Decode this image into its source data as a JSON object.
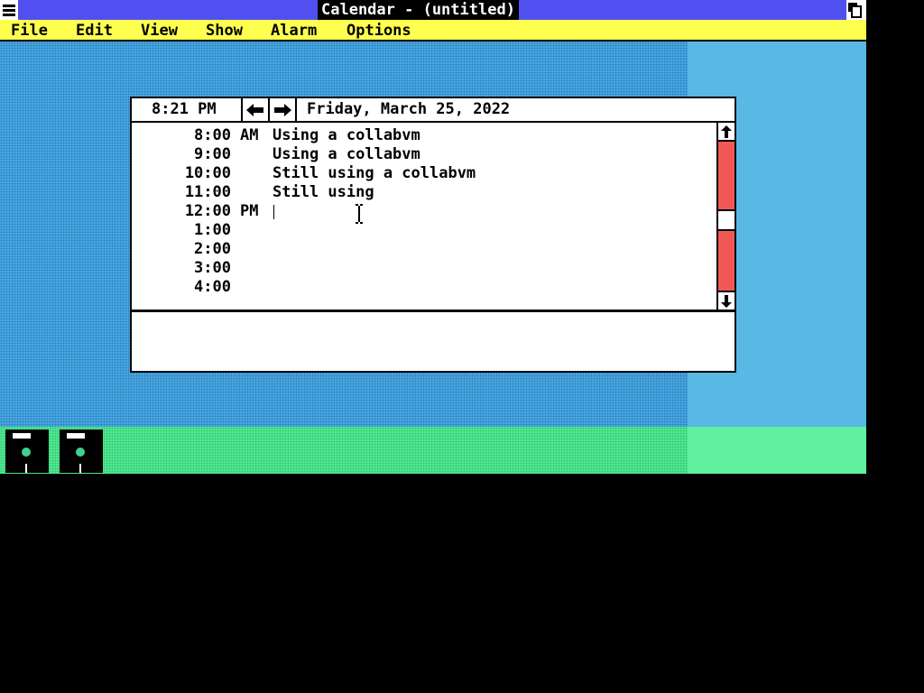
{
  "window": {
    "title": "Calendar - (untitled)",
    "system_menu_icon": "system-menu-icon",
    "maximize_icon": "maximize-icon"
  },
  "menubar": {
    "items": [
      "File",
      "Edit",
      "View",
      "Show",
      "Alarm",
      "Options"
    ]
  },
  "calendar": {
    "current_time": "8:21 PM",
    "prev_icon": "left-arrow-icon",
    "next_icon": "right-arrow-icon",
    "date": "Friday, March 25, 2022",
    "schedule": [
      {
        "time": "8:00",
        "ampm": "AM",
        "text": "Using a collabvm"
      },
      {
        "time": "9:00",
        "ampm": "",
        "text": "Using a collabvm"
      },
      {
        "time": "10:00",
        "ampm": "",
        "text": "Still using a collabvm"
      },
      {
        "time": "11:00",
        "ampm": "",
        "text": "Still using"
      },
      {
        "time": "12:00",
        "ampm": "PM",
        "text": ""
      },
      {
        "time": "1:00",
        "ampm": "",
        "text": ""
      },
      {
        "time": "2:00",
        "ampm": "",
        "text": ""
      },
      {
        "time": "3:00",
        "ampm": "",
        "text": ""
      },
      {
        "time": "4:00",
        "ampm": "",
        "text": ""
      }
    ],
    "notes": ""
  },
  "colors": {
    "titlebar": "#5050f0",
    "menubar": "#ffff50",
    "desktop": "#4aa8dc",
    "iconbar": "#50e890",
    "scrollbar": "#f05858"
  },
  "desktop_icons": [
    "disk-drive-icon",
    "disk-drive-icon"
  ]
}
